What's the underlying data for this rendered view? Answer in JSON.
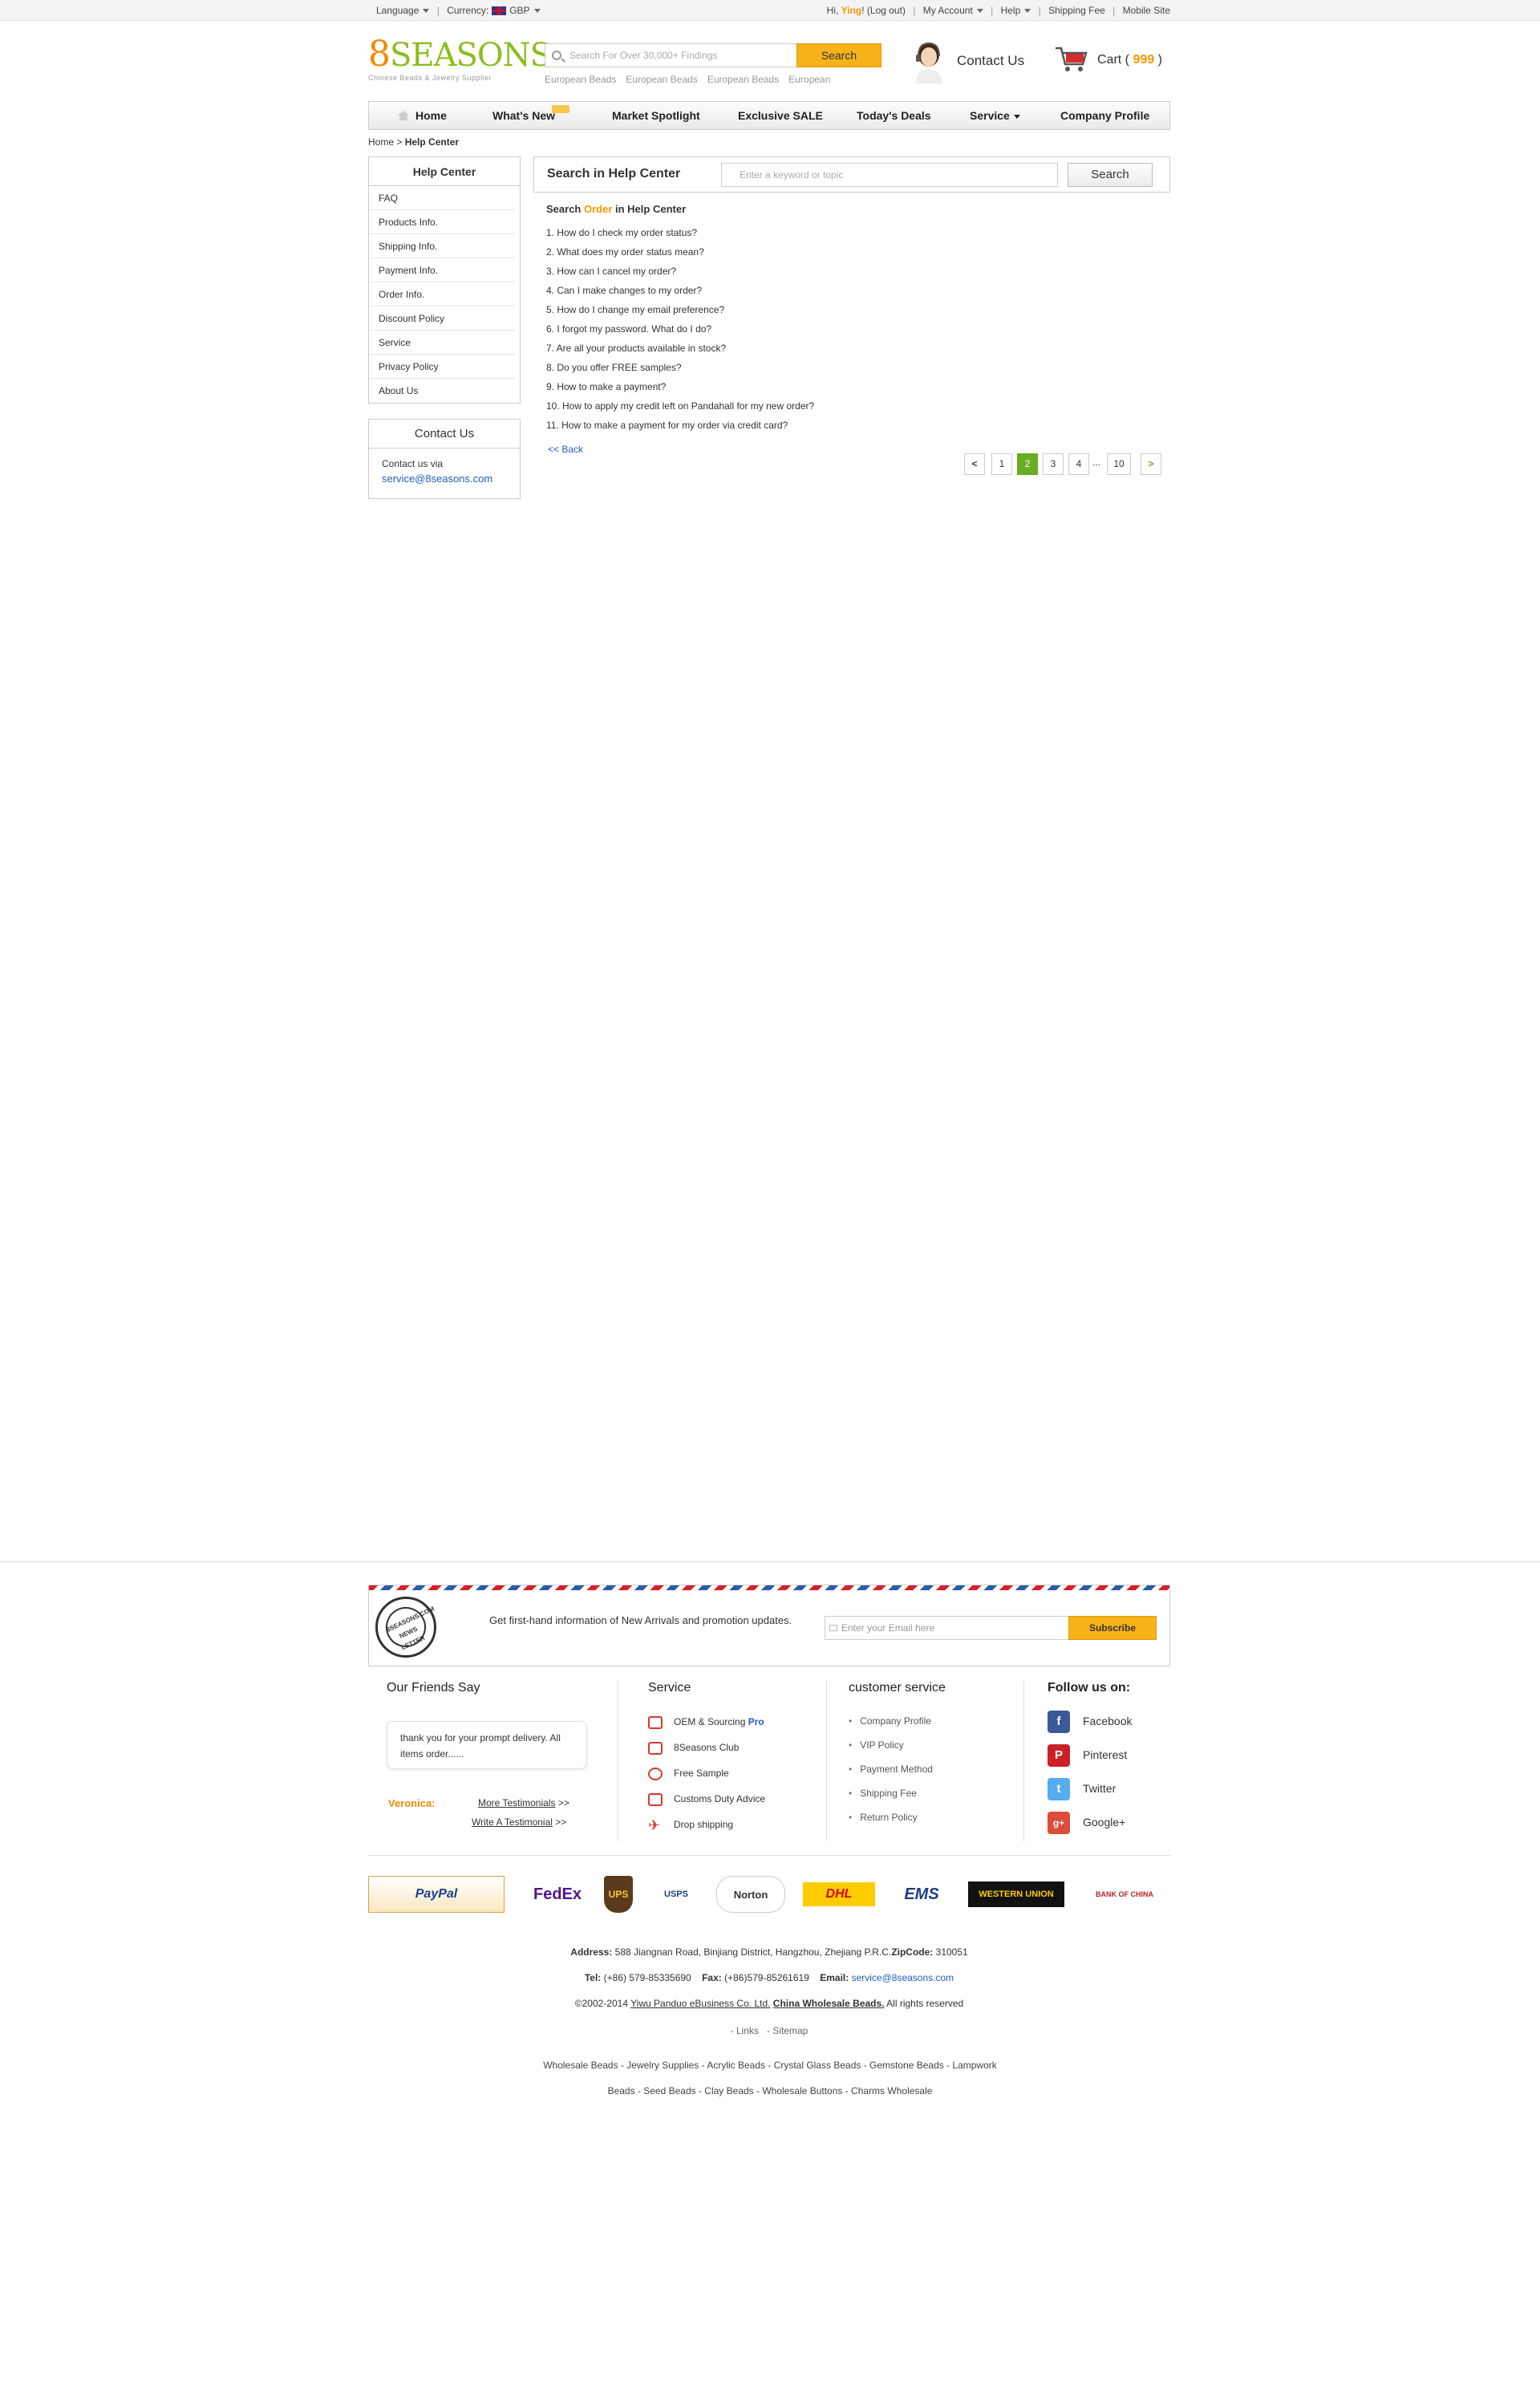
{
  "topbar": {
    "language": "Language",
    "currency_label": "Currency:",
    "currency_value": "GBP",
    "greeting_pre": "Hi, ",
    "user": "Ying",
    "greeting_mid": "! ",
    "logout": "(Log out)",
    "my_account": "My Account",
    "help": "Help",
    "shipping_fee": "Shipping Fee",
    "mobile_site": "Mobile Site"
  },
  "header": {
    "logo_main": "8",
    "logo_word": "SEASONS",
    "logo_tagline": "Chinese Beads & Jewelry Supplier",
    "search_placeholder": "Search For Over 30,000+ Findings",
    "search_button": "Search",
    "hot_keywords": [
      "European Beads",
      "European Beads",
      "European Beads",
      "European"
    ],
    "contact_us": "Contact Us",
    "cart_label": "Cart",
    "cart_count": "999"
  },
  "nav": {
    "items": [
      "Home",
      "What's New",
      "Market Spotlight",
      "Exclusive SALE",
      "Today's Deals",
      "Service",
      "Company Profile"
    ]
  },
  "breadcrumb": {
    "home": "Home",
    "separator": ">",
    "current": "Help Center"
  },
  "sidebar": {
    "title": "Help Center",
    "items": [
      "FAQ",
      "Products Info.",
      "Shipping Info.",
      "Payment Info.",
      "Order Info.",
      "Discount Policy",
      "Service",
      "Privacy Policy",
      "About Us"
    ],
    "contact_title": "Contact Us",
    "contact_text": "Contact us via",
    "contact_email": "service@8seasons.com"
  },
  "main": {
    "title": "Search in Help Center",
    "search_placeholder": "Enter a keyword or topic",
    "search_button": "Search",
    "result_pre": "Search ",
    "result_keyword": "Order",
    "result_post": " in Help Center",
    "questions": [
      "1. How do I check my order status?",
      "2. What does my order status mean?",
      "3. How can I cancel my order?",
      "4. Can I make changes to my order?",
      "5. How do I change my email preference?",
      "6. I forgot my password. What do I do?",
      "7. Are all your products available in stock?",
      "8. Do you offer FREE samples?",
      "9. How to make a payment?",
      "10. How to apply my credit left on Pandahall for my new order?",
      "11. How to make a payment for my order via credit card?"
    ],
    "back": "<< Back",
    "pager": {
      "prev": "<",
      "pages": [
        "1",
        "2",
        "3",
        "4"
      ],
      "dots": "...",
      "last": "10",
      "next": ">",
      "current": "2"
    }
  },
  "newsletter": {
    "stamp_text": "8SEASONS.COM NEWS LETTER",
    "text": "Get first-hand information of New Arrivals and promotion updates.",
    "placeholder": "Enter your Email here",
    "button": "Subscribe"
  },
  "footer": {
    "friends_title": "Our Friends Say",
    "testimonial": "thank you for your prompt delivery. All items order......",
    "testimonial_author": "Veronica:",
    "more_testimonials": "More Testimonials",
    "write_testimonial": "Write A Testimonial",
    "arrow": ">>",
    "service_title": "Service",
    "service_items": [
      "OEM & Sourcing",
      "8Seasons Club",
      "Free Sample",
      "Customs Duty Advice",
      "Drop shipping"
    ],
    "service_pro": "Pro",
    "cs_title": "customer service",
    "cs_items": [
      "Company Profile",
      "VIP Policy",
      "Payment Method",
      "Shipping Fee",
      "Return Policy"
    ],
    "follow_title": "Follow us on:",
    "follow_items": [
      "Facebook",
      "Pinterest",
      "Twitter",
      "Google+"
    ],
    "partner_logos": [
      "PayPal",
      "FedEx",
      "UPS",
      "USPS",
      "Norton",
      "DHL",
      "EMS",
      "WESTERN UNION",
      "BANK OF CHINA"
    ],
    "address_label": "Address:",
    "address": "588 Jiangnan Road, Binjiang District, Hangzhou, Zhejiang P.R.C.",
    "zip_label": "ZipCode:",
    "zip": "310051",
    "tel_label": "Tel:",
    "tel": "(+86) 579-85335690",
    "fax_label": "Fax:",
    "fax": "(+86)579-85261619",
    "email_label": "Email:",
    "email": "service@8seasons.com",
    "copyright_pre": "©2002-2014",
    "company": "Yiwu Panduo eBusiness Co. Ltd.",
    "site_name": "China Wholesale Beads.",
    "rights": "All rights reserved",
    "links": "- Links",
    "sitemap": "- Sitemap",
    "tags_line1": "Wholesale Beads - Jewelry Supplies - Acrylic Beads - Crystal Glass Beads - Gemstone Beads - Lampwork",
    "tags_line2": "Beads - Seed Beads - Clay Beads - Wholesale Buttons - Charms Wholesale"
  },
  "colors": {
    "accent": "#f7b21a",
    "orange": "#f39800",
    "green": "#6aac22",
    "link": "#1f5dbb"
  }
}
